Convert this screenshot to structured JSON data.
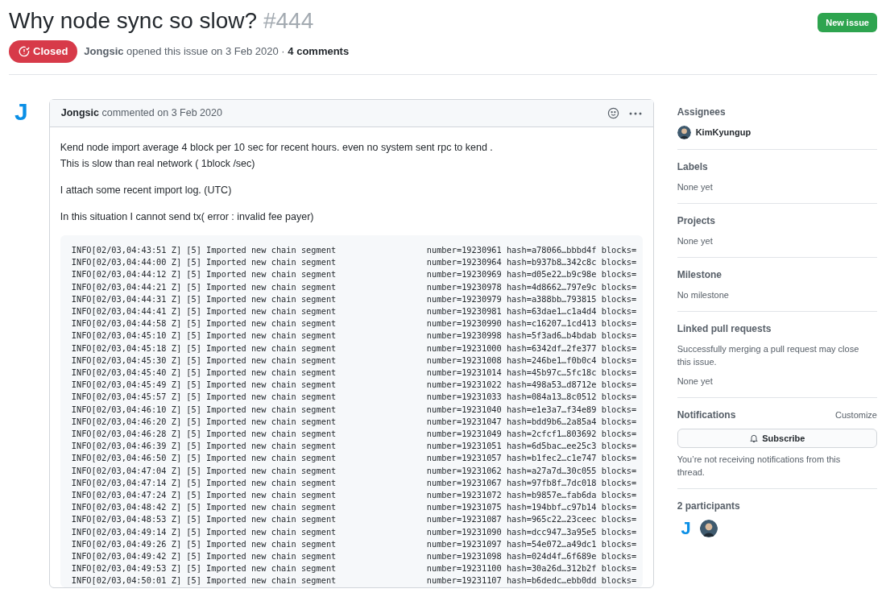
{
  "issue": {
    "title": "Why node sync so slow?",
    "number": "#444",
    "closed": true,
    "state_label": "Closed",
    "author": "Jongsic",
    "meta": "opened this issue on 3 Feb 2020 ·",
    "comments": "4 comments"
  },
  "new_issue_button": "New issue",
  "comment": {
    "avatar_letter": "J",
    "author": "Jongsic",
    "meta": "commented on 3 Feb 2020",
    "paragraphs": [
      [
        "Kend node import average 4 block per 10 sec for recent hours. even no system sent rpc to kend .",
        "This is slow than real network ( 1block /sec)"
      ],
      [
        "I attach some recent import log. (UTC)"
      ],
      [
        "In this situation I cannot send tx( error : invalid fee payer)"
      ]
    ],
    "log": [
      {
        "message": "INFO[02/03,04:43:51 Z] [5] Imported new chain segment",
        "fields": "number=19230961 hash=a78066…bbbd4f blocks="
      },
      {
        "message": "INFO[02/03,04:44:00 Z] [5] Imported new chain segment",
        "fields": "number=19230964 hash=b937b8…342c8c blocks="
      },
      {
        "message": "INFO[02/03,04:44:12 Z] [5] Imported new chain segment",
        "fields": "number=19230969 hash=d05e22…b9c98e blocks="
      },
      {
        "message": "INFO[02/03,04:44:21 Z] [5] Imported new chain segment",
        "fields": "number=19230978 hash=4d8662…797e9c blocks="
      },
      {
        "message": "INFO[02/03,04:44:31 Z] [5] Imported new chain segment",
        "fields": "number=19230979 hash=a388bb…793815 blocks="
      },
      {
        "message": "INFO[02/03,04:44:41 Z] [5] Imported new chain segment",
        "fields": "number=19230981 hash=63dae1…c1a4d4 blocks="
      },
      {
        "message": "INFO[02/03,04:44:58 Z] [5] Imported new chain segment",
        "fields": "number=19230990 hash=c16207…1cd413 blocks="
      },
      {
        "message": "INFO[02/03,04:45:10 Z] [5] Imported new chain segment",
        "fields": "number=19230998 hash=5f3ad6…b4bdab blocks="
      },
      {
        "message": "INFO[02/03,04:45:18 Z] [5] Imported new chain segment",
        "fields": "number=19231000 hash=6342df…2fe377 blocks="
      },
      {
        "message": "INFO[02/03,04:45:30 Z] [5] Imported new chain segment",
        "fields": "number=19231008 hash=246be1…f0b0c4 blocks="
      },
      {
        "message": "INFO[02/03,04:45:40 Z] [5] Imported new chain segment",
        "fields": "number=19231014 hash=45b97c…5fc18c blocks="
      },
      {
        "message": "INFO[02/03,04:45:49 Z] [5] Imported new chain segment",
        "fields": "number=19231022 hash=498a53…d8712e blocks="
      },
      {
        "message": "INFO[02/03,04:45:57 Z] [5] Imported new chain segment",
        "fields": "number=19231033 hash=084a13…8c0512 blocks="
      },
      {
        "message": "INFO[02/03,04:46:10 Z] [5] Imported new chain segment",
        "fields": "number=19231040 hash=e1e3a7…f34e89 blocks="
      },
      {
        "message": "INFO[02/03,04:46:20 Z] [5] Imported new chain segment",
        "fields": "number=19231047 hash=bdd9b6…2a85a4 blocks="
      },
      {
        "message": "INFO[02/03,04:46:28 Z] [5] Imported new chain segment",
        "fields": "number=19231049 hash=2cfcf1…803692 blocks="
      },
      {
        "message": "INFO[02/03,04:46:39 Z] [5] Imported new chain segment",
        "fields": "number=19231051 hash=6d5bac…ee25c3 blocks="
      },
      {
        "message": "INFO[02/03,04:46:50 Z] [5] Imported new chain segment",
        "fields": "number=19231057 hash=b1fec2…c1e747 blocks="
      },
      {
        "message": "INFO[02/03,04:47:04 Z] [5] Imported new chain segment",
        "fields": "number=19231062 hash=a27a7d…30c055 blocks="
      },
      {
        "message": "INFO[02/03,04:47:14 Z] [5] Imported new chain segment",
        "fields": "number=19231067 hash=97fb8f…7dc018 blocks="
      },
      {
        "message": "INFO[02/03,04:47:24 Z] [5] Imported new chain segment",
        "fields": "number=19231072 hash=b9857e…fab6da blocks="
      },
      {
        "message": "INFO[02/03,04:48:42 Z] [5] Imported new chain segment",
        "fields": "number=19231075 hash=194bbf…c97b14 blocks="
      },
      {
        "message": "INFO[02/03,04:48:53 Z] [5] Imported new chain segment",
        "fields": "number=19231087 hash=965c22…23ceec blocks="
      },
      {
        "message": "INFO[02/03,04:49:14 Z] [5] Imported new chain segment",
        "fields": "number=19231090 hash=dcc947…3a95e5 blocks="
      },
      {
        "message": "INFO[02/03,04:49:26 Z] [5] Imported new chain segment",
        "fields": "number=19231097 hash=54e072…a49dc1 blocks="
      },
      {
        "message": "INFO[02/03,04:49:42 Z] [5] Imported new chain segment",
        "fields": "number=19231098 hash=024d4f…6f689e blocks="
      },
      {
        "message": "INFO[02/03,04:49:53 Z] [5] Imported new chain segment",
        "fields": "number=19231100 hash=30a26d…312b2f blocks="
      },
      {
        "message": "INFO[02/03,04:50:01 Z] [5] Imported new chain segment",
        "fields": "number=19231107 hash=b6dedc…ebb0dd blocks="
      }
    ]
  },
  "sidebar": {
    "sections": [
      {
        "kind": "assignees",
        "title": "Assignees",
        "people": [
          {
            "name": "KimKyungup"
          }
        ]
      },
      {
        "kind": "text",
        "title": "Labels",
        "lines": [
          "None yet"
        ]
      },
      {
        "kind": "text",
        "title": "Projects",
        "lines": [
          "None yet"
        ]
      },
      {
        "kind": "text",
        "title": "Milestone",
        "lines": [
          "No milestone"
        ]
      },
      {
        "kind": "text",
        "title": "Linked pull requests",
        "lines": [
          "Successfully merging a pull request may close this issue.",
          "None yet"
        ]
      },
      {
        "kind": "notifications",
        "title": "Notifications",
        "action": "Customize",
        "button": "Subscribe",
        "note": "You’re not receiving notifications from this thread."
      },
      {
        "kind": "participants",
        "title": "2 participants",
        "participants": [
          {
            "kind": "letter",
            "letter": "J"
          },
          {
            "kind": "photo"
          }
        ]
      }
    ]
  }
}
